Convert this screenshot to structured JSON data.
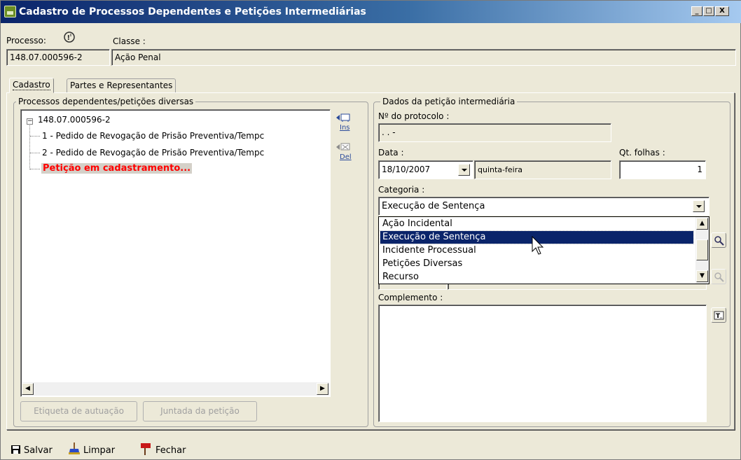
{
  "window": {
    "title": "Cadastro de Processos Dependentes e Petições Intermediárias"
  },
  "header": {
    "processo_label": "Processo:",
    "classe_label": "Classe :",
    "processo_value": "148.07.000596-2",
    "classe_value": "Ação Penal"
  },
  "tabs": [
    {
      "label": "Cadastro",
      "active": true
    },
    {
      "label": "Partes e Representantes",
      "active": false
    }
  ],
  "left_group": {
    "title": "Processos dependentes/petições diversas",
    "tree": {
      "root": "148.07.000596-2",
      "children": [
        "1 - Pedido de Revogação de Prisão Preventiva/Tempc",
        "2 - Pedido de Revogação de Prisão Preventiva/Tempc",
        "Petição em cadastramento..."
      ]
    },
    "ins_label": "Ins",
    "del_label": "Del",
    "etiqueta_button": "Etiqueta de autuação",
    "juntada_button": "Juntada da petição"
  },
  "right_group": {
    "title": "Dados da petição intermediária",
    "protocolo_label": "Nº do protocolo :",
    "protocolo_value": " .  .        -",
    "data_label": "Data :",
    "data_value": "18/10/2007",
    "weekday_value": "quinta-feira",
    "qt_folhas_label": "Qt. folhas :",
    "qt_folhas_value": "1",
    "categoria_label": "Categoria :",
    "categoria_value": "Execução de Sentença",
    "categoria_options": [
      "Ação Incidental",
      "Execução de Sentença",
      "Incidente Processual",
      "Petições Diversas",
      "Recurso"
    ],
    "categoria_selected_index": 1,
    "complemento_label": "Complemento :",
    "complemento_value": ""
  },
  "bottom_toolbar": {
    "salvar": "Salvar",
    "limpar": "Limpar",
    "fechar": "Fechar"
  },
  "colors": {
    "title_bar": "#0a246a",
    "selection": "#0a246a",
    "new_petition_text": "#ff0000",
    "window_bg": "#ece9d8"
  }
}
